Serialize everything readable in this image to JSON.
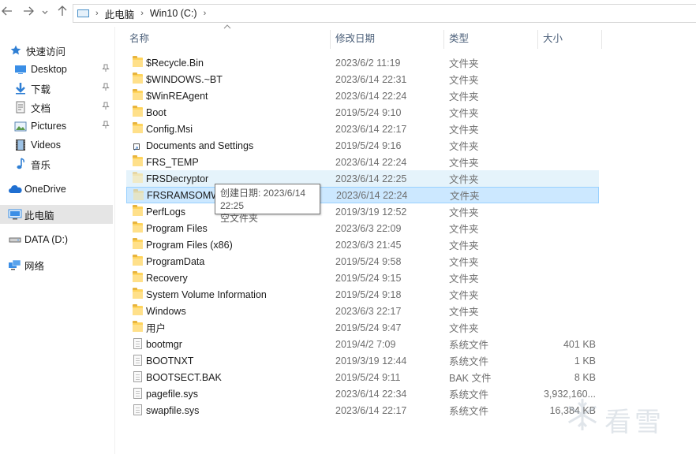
{
  "address_bar": {
    "back_icon": "arrow-left-icon",
    "forward_icon": "arrow-right-icon",
    "recent_icon": "chevron-down-icon",
    "up_icon": "arrow-up-icon",
    "breadcrumb": [
      "此电脑",
      "Win10 (C:)"
    ]
  },
  "nav_pane": {
    "items": [
      {
        "label": "快速访问",
        "icon": "star-icon",
        "pinned": false
      },
      {
        "label": "Desktop",
        "icon": "desktop-icon",
        "pinned": true
      },
      {
        "label": "下载",
        "icon": "download-icon",
        "pinned": true
      },
      {
        "label": "文档",
        "icon": "document-icon",
        "pinned": true
      },
      {
        "label": "Pictures",
        "icon": "pictures-icon",
        "pinned": true
      },
      {
        "label": "Videos",
        "icon": "videos-icon",
        "pinned": false
      },
      {
        "label": "音乐",
        "icon": "music-icon",
        "pinned": false
      },
      {
        "label": "OneDrive",
        "icon": "cloud-icon",
        "pinned": false
      },
      {
        "label": "此电脑",
        "icon": "computer-icon",
        "pinned": false,
        "selected": true
      },
      {
        "label": "DATA (D:)",
        "icon": "drive-icon",
        "pinned": false
      },
      {
        "label": "网络",
        "icon": "network-icon",
        "pinned": false
      }
    ]
  },
  "columns": {
    "name": "名称",
    "date": "修改日期",
    "type": "类型",
    "size": "大小"
  },
  "files": [
    {
      "name": "$Recycle.Bin",
      "date": "2023/6/2 11:19",
      "type": "文件夹",
      "size": "",
      "icon": "folder-icon"
    },
    {
      "name": "$WINDOWS.~BT",
      "date": "2023/6/14 22:31",
      "type": "文件夹",
      "size": "",
      "icon": "folder-icon"
    },
    {
      "name": "$WinREAgent",
      "date": "2023/6/14 22:24",
      "type": "文件夹",
      "size": "",
      "icon": "folder-icon"
    },
    {
      "name": "Boot",
      "date": "2019/5/24 9:10",
      "type": "文件夹",
      "size": "",
      "icon": "folder-icon"
    },
    {
      "name": "Config.Msi",
      "date": "2023/6/14 22:17",
      "type": "文件夹",
      "size": "",
      "icon": "folder-icon"
    },
    {
      "name": "Documents and Settings",
      "date": "2019/5/24 9:16",
      "type": "文件夹",
      "size": "",
      "icon": "shortcut-folder-icon"
    },
    {
      "name": "FRS_TEMP",
      "date": "2023/6/14 22:24",
      "type": "文件夹",
      "size": "",
      "icon": "folder-icon"
    },
    {
      "name": "FRSDecryptor",
      "date": "2023/6/14 22:25",
      "type": "文件夹",
      "size": "",
      "icon": "folder-icon",
      "state": "hover"
    },
    {
      "name": "FRSRAMSOMW",
      "date": "2023/6/14 22:24",
      "type": "文件夹",
      "size": "",
      "icon": "folder-icon",
      "state": "selected"
    },
    {
      "name": "PerfLogs",
      "date": "2019/3/19 12:52",
      "type": "文件夹",
      "size": "",
      "icon": "folder-icon"
    },
    {
      "name": "Program Files",
      "date": "2023/6/3 22:09",
      "type": "文件夹",
      "size": "",
      "icon": "folder-icon"
    },
    {
      "name": "Program Files (x86)",
      "date": "2023/6/3 21:45",
      "type": "文件夹",
      "size": "",
      "icon": "folder-icon"
    },
    {
      "name": "ProgramData",
      "date": "2019/5/24 9:58",
      "type": "文件夹",
      "size": "",
      "icon": "folder-icon"
    },
    {
      "name": "Recovery",
      "date": "2019/5/24 9:15",
      "type": "文件夹",
      "size": "",
      "icon": "folder-icon"
    },
    {
      "name": "System Volume Information",
      "date": "2019/5/24 9:18",
      "type": "文件夹",
      "size": "",
      "icon": "folder-icon"
    },
    {
      "name": "Windows",
      "date": "2023/6/3 22:17",
      "type": "文件夹",
      "size": "",
      "icon": "folder-icon"
    },
    {
      "name": "用户",
      "date": "2019/5/24 9:47",
      "type": "文件夹",
      "size": "",
      "icon": "folder-icon"
    },
    {
      "name": "bootmgr",
      "date": "2019/4/2 7:09",
      "type": "系统文件",
      "size": "401 KB",
      "icon": "file-icon"
    },
    {
      "name": "BOOTNXT",
      "date": "2019/3/19 12:44",
      "type": "系统文件",
      "size": "1 KB",
      "icon": "file-icon"
    },
    {
      "name": "BOOTSECT.BAK",
      "date": "2019/5/24 9:11",
      "type": "BAK 文件",
      "size": "8 KB",
      "icon": "file-icon"
    },
    {
      "name": "pagefile.sys",
      "date": "2023/6/14 22:34",
      "type": "系统文件",
      "size": "3,932,160...",
      "icon": "file-icon"
    },
    {
      "name": "swapfile.sys",
      "date": "2023/6/14 22:17",
      "type": "系统文件",
      "size": "16,384 KB",
      "icon": "file-icon"
    }
  ],
  "tooltip": {
    "line1": "创建日期: 2023/6/14 22:25",
    "line2": "空文件夹"
  },
  "watermark": {
    "text": "看雪",
    "icon": "snowflake-icon"
  },
  "colors": {
    "hover": "#e5f3fb",
    "selected": "#cce8ff",
    "selected_border": "#99d1ff",
    "header_text": "#4c607a",
    "folder": "#ffd45c"
  }
}
